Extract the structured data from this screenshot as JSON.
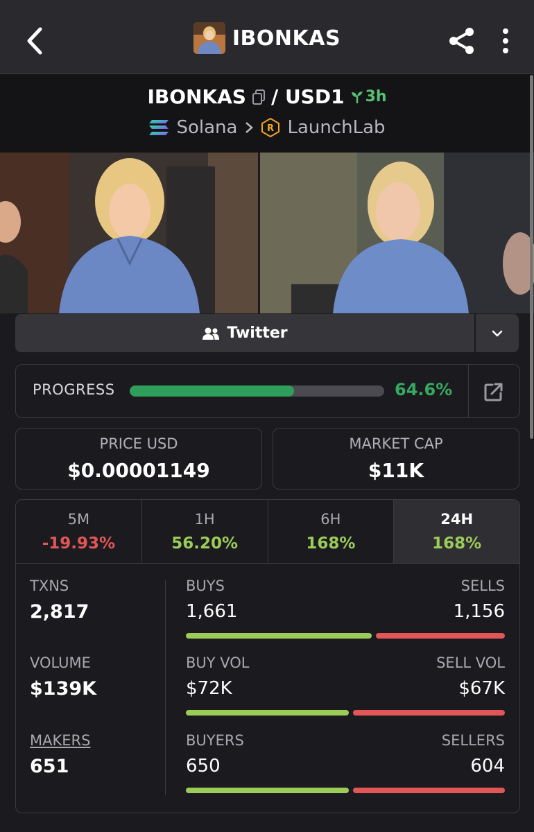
{
  "header": {
    "title": "IBONKAS",
    "back_icon": "chevron-left-icon",
    "share_icon": "share-icon",
    "more_icon": "more-vertical-icon"
  },
  "pair": {
    "base": "IBONKAS",
    "quote": "/ USD1",
    "age": "3h",
    "chain": "Solana",
    "launchpad": "LaunchLab"
  },
  "links": {
    "twitter_label": "Twitter"
  },
  "progress": {
    "label": "PROGRESS",
    "value_text": "64.6%",
    "fraction": 0.646
  },
  "stats": {
    "price_label": "PRICE USD",
    "price_value": "$0.00001149",
    "mcap_label": "MARKET CAP",
    "mcap_value": "$11K"
  },
  "tabs": [
    {
      "name": "5M",
      "change": "-19.93%",
      "dir": "neg"
    },
    {
      "name": "1H",
      "change": "56.20%",
      "dir": "pos"
    },
    {
      "name": "6H",
      "change": "168%",
      "dir": "pos"
    },
    {
      "name": "24H",
      "change": "168%",
      "dir": "pos",
      "active": true
    }
  ],
  "metrics": {
    "txns_label": "TXNS",
    "txns_value": "2,817",
    "volume_label": "VOLUME",
    "volume_value": "$139K",
    "makers_label": "MAKERS",
    "makers_value": "651",
    "buys_label": "BUYS",
    "buys_value": "1,661",
    "sells_label": "SELLS",
    "sells_value": "1,156",
    "buyvol_label": "BUY VOL",
    "buyvol_value": "$72K",
    "sellvol_label": "SELL VOL",
    "sellvol_value": "$67K",
    "buyers_label": "BUYERS",
    "buyers_value": "650",
    "sellers_label": "SELLERS",
    "sellers_value": "604"
  },
  "bars": {
    "buys_fraction": 0.59,
    "buyvol_fraction": 0.518,
    "buyers_fraction": 0.518
  },
  "colors": {
    "positive": "#9ccc58",
    "negative": "#e35656",
    "progress": "#2f9e5b"
  }
}
